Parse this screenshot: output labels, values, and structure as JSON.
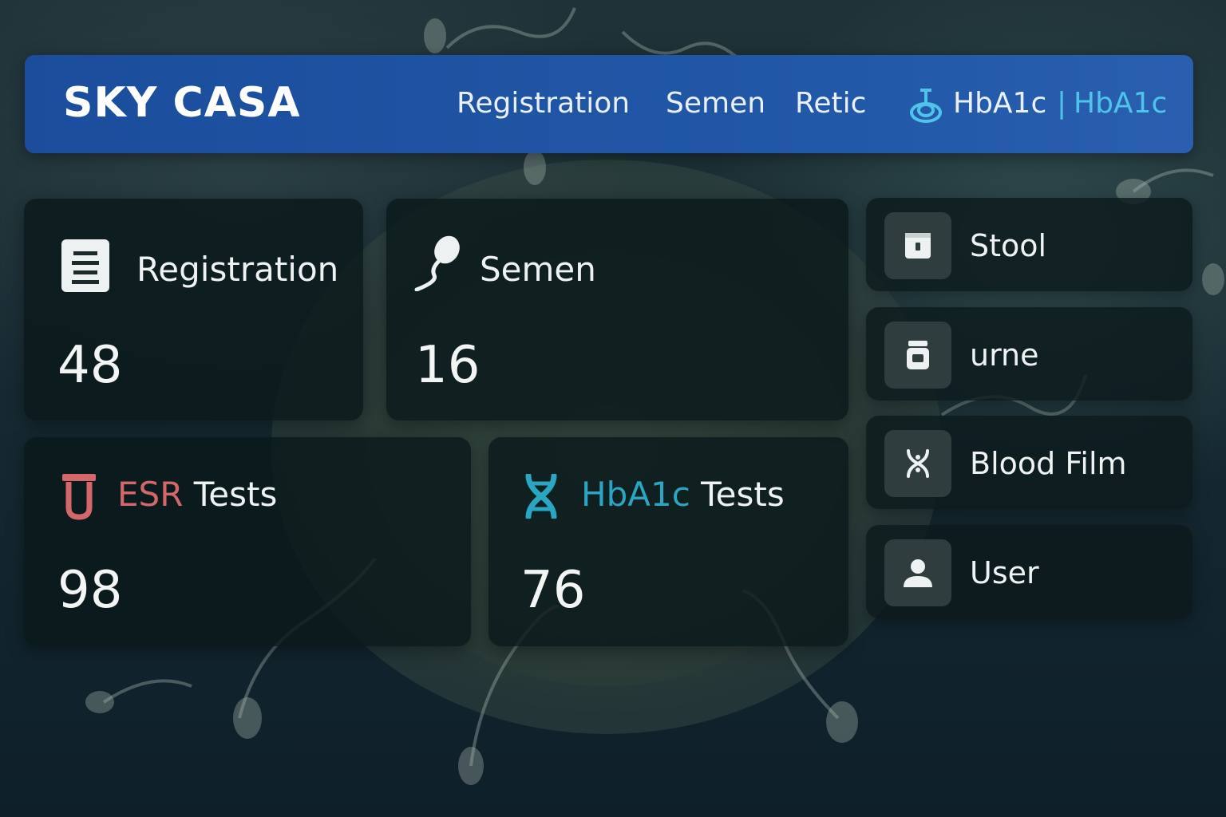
{
  "app": {
    "brand": "SKY CASA"
  },
  "nav": {
    "items": [
      "Registration",
      "Semen",
      "Retic"
    ],
    "hba1c_label": "HbA1c",
    "separator": "|",
    "hba1c_accent": "HbA1c"
  },
  "cards": {
    "registration": {
      "label": "Registration",
      "value": "48",
      "icon": "document-icon"
    },
    "semen": {
      "label": "Semen",
      "value": "16",
      "icon": "sperm-icon"
    },
    "esr": {
      "label_accent": "ESR",
      "label_rest": " Tests",
      "value": "98",
      "icon": "test-tube-icon"
    },
    "hba1c": {
      "label_accent": "HbA1c",
      "label_rest": " Tests",
      "value": "76",
      "icon": "dna-icon"
    }
  },
  "sidebar": {
    "items": [
      {
        "label": "Stool",
        "icon": "stool-container-icon"
      },
      {
        "label": "urne",
        "icon": "urine-jar-icon"
      },
      {
        "label": "Blood Film",
        "icon": "blood-film-icon"
      },
      {
        "label": "User",
        "icon": "user-icon"
      }
    ]
  },
  "colors": {
    "topbar": "#2258a8",
    "accent_cyan": "#4fc3ea",
    "esr_red": "#d4676c",
    "hba1c_teal": "#2aa6c2",
    "card_bg": "#0a181a"
  }
}
